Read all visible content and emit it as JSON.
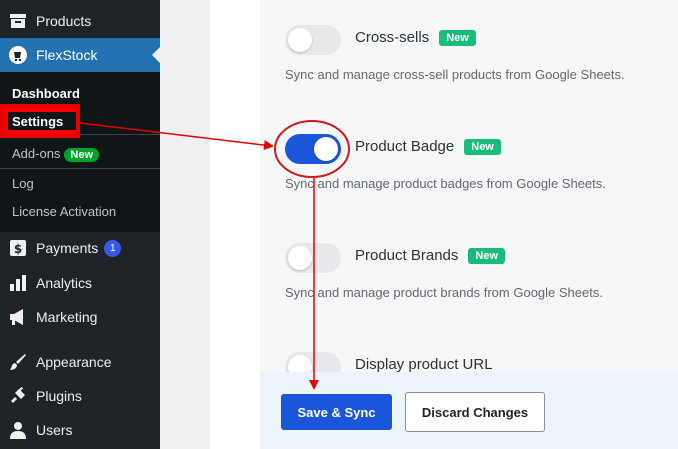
{
  "sidebar": {
    "items": [
      {
        "label": "Products",
        "icon": "archive-icon"
      },
      {
        "label": "FlexStock",
        "icon": "flexstock-logo-icon"
      },
      {
        "label": "Payments",
        "icon": "dollar-icon",
        "count": "1"
      },
      {
        "label": "Analytics",
        "icon": "bar-chart-icon"
      },
      {
        "label": "Marketing",
        "icon": "megaphone-icon"
      },
      {
        "label": "Appearance",
        "icon": "paintbrush-icon"
      },
      {
        "label": "Plugins",
        "icon": "plug-icon"
      },
      {
        "label": "Users",
        "icon": "user-icon"
      }
    ],
    "submenu": {
      "dashboard": "Dashboard",
      "settings": "Settings",
      "addons": "Add-ons",
      "addons_badge": "New",
      "log": "Log",
      "license": "License Activation"
    }
  },
  "settings": [
    {
      "title": "Cross-sells",
      "badge": "New",
      "description": "Sync and manage cross-sell products from Google Sheets.",
      "enabled": false
    },
    {
      "title": "Product Badge",
      "badge": "New",
      "description": "Sync and manage product badges from Google Sheets.",
      "enabled": true
    },
    {
      "title": "Product Brands",
      "badge": "New",
      "description": "Sync and manage product brands from Google Sheets.",
      "enabled": false
    },
    {
      "title": "Display product URL",
      "enabled": false
    }
  ],
  "footer": {
    "save_label": "Save & Sync",
    "discard_label": "Discard Changes"
  },
  "colors": {
    "sidebar_bg": "#1d2327",
    "accent": "#1a56db",
    "annotation": "#e60000",
    "badge_green": "#1abc7a"
  }
}
